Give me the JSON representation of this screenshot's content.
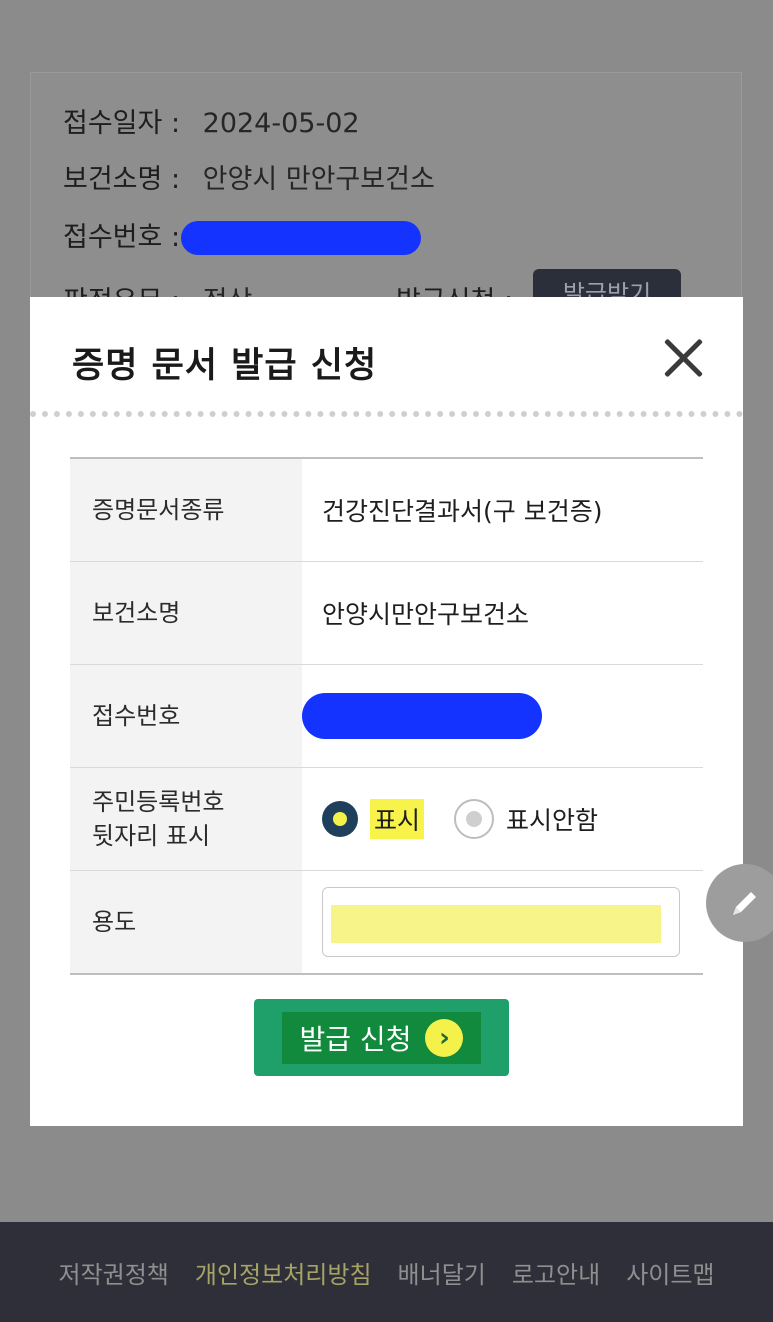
{
  "background": {
    "receipt_date_label": "접수일자 :",
    "receipt_date_value": "2024-05-02",
    "health_center_label": "보건소명 :",
    "health_center_value": "안양시 만안구보건소",
    "receipt_no_label": "접수번호 :",
    "judgment_label": "판정유무 :",
    "judgment_value": "정상",
    "issue_label": "발급신청 :",
    "issue_button": "발급받기"
  },
  "modal": {
    "title": "증명 문서 발급 신청",
    "rows": [
      {
        "label": "증명문서종류",
        "value": "건강진단결과서(구 보건증)"
      },
      {
        "label": "보건소명",
        "value": "안양시만안구보건소"
      },
      {
        "label": "접수번호",
        "value": ""
      },
      {
        "label": "주민등록번호\n뒷자리 표시",
        "value": ""
      },
      {
        "label": "용도",
        "value": ""
      }
    ],
    "radio": {
      "option_show": "표시",
      "option_hide": "표시안함",
      "selected": "표시"
    },
    "submit_label": "발급 신청"
  },
  "colors": {
    "accent_green": "#1fa06a",
    "highlight_yellow": "#f7f34a",
    "redaction_blue": "#1433ff"
  },
  "footer": {
    "links": [
      "저작권정책",
      "개인정보처리방침",
      "배너달기",
      "로고안내",
      "사이트맵"
    ]
  }
}
